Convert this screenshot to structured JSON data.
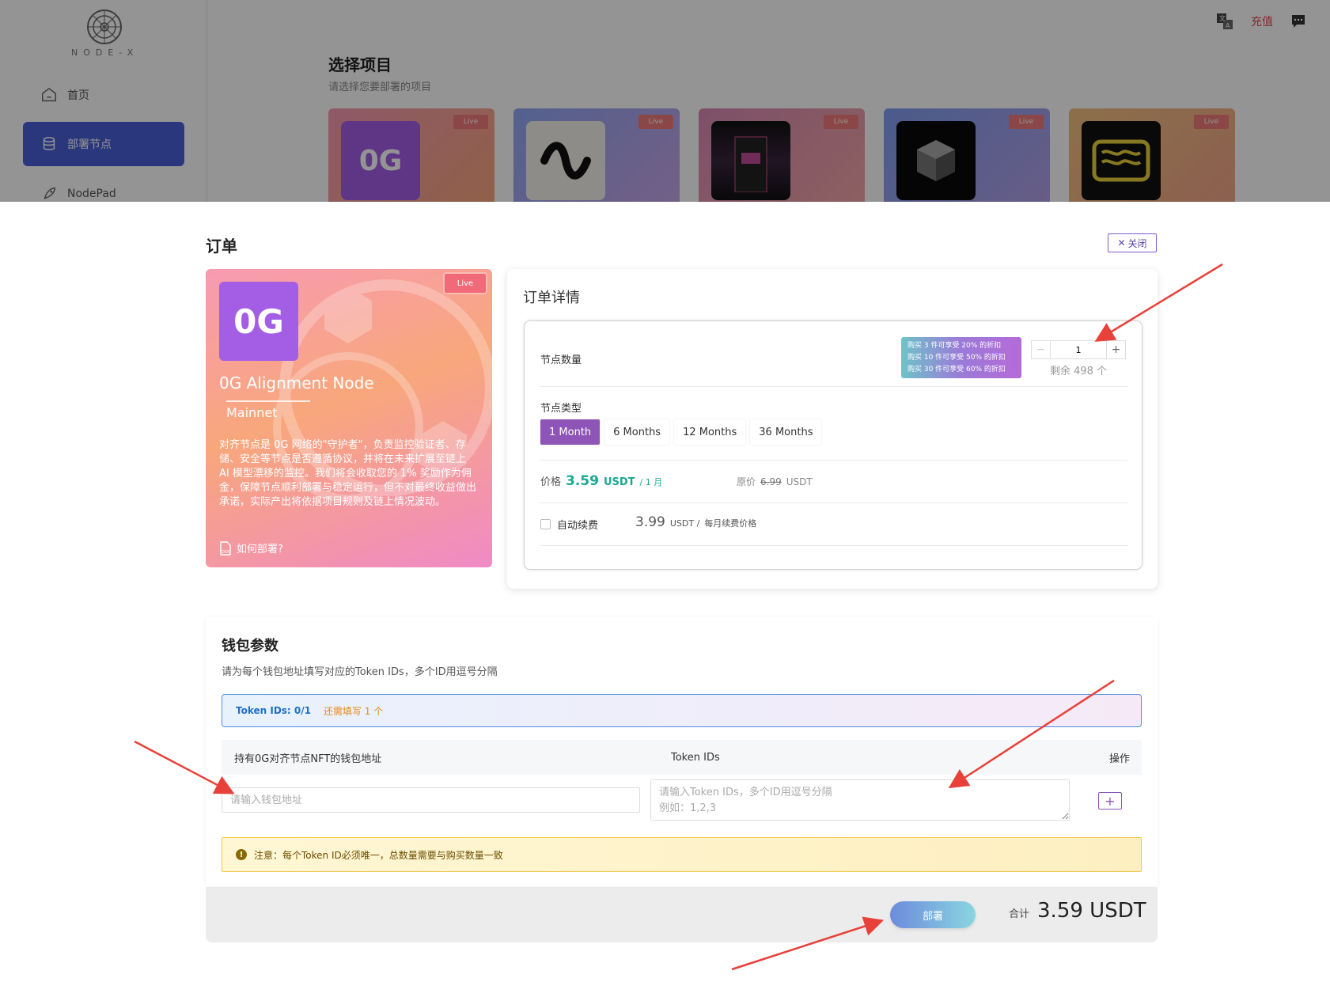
{
  "app": {
    "logo_text": "NODE-X",
    "recharge_label": "充值"
  },
  "sidebar": {
    "items": [
      {
        "label": "首页",
        "icon": "home-icon",
        "active": false
      },
      {
        "label": "部署节点",
        "icon": "database-icon",
        "active": true
      },
      {
        "label": "NodePad",
        "icon": "rocket-icon",
        "active": false
      }
    ]
  },
  "background_page": {
    "title": "选择项目",
    "subtitle": "请选择您要部署的项目",
    "projects": [
      {
        "badge": "Live",
        "logo_text": "0G"
      },
      {
        "badge": "Live",
        "logo_text": ""
      },
      {
        "badge": "Live",
        "logo_text": ""
      },
      {
        "badge": "Live",
        "logo_text": ""
      },
      {
        "badge": "Live",
        "logo_text": ""
      }
    ]
  },
  "order": {
    "title": "订单",
    "close_label": "关闭",
    "node": {
      "badge": "Live",
      "logo_text": "0G",
      "name": "0G Alignment Node",
      "network": "Mainnet",
      "description": "对齐节点是 0G 网络的\"守护者\"，负责监控验证者、存储、安全等节点是否遵循协议，并将在未来扩展至链上 AI 模型漂移的监控。我们将会收取您的 1% 奖励作为佣金，保障节点顺利部署与稳定运行，但不对最终收益做出承诺，实际产出将依据项目规则及链上情况波动。",
      "how_label": "如何部署?"
    },
    "details": {
      "title": "订单详情",
      "quantity_label": "节点数量",
      "promo_lines": [
        "购买 3 件可享受 20% 的折扣",
        "购买 10 件可享受 50% 的折扣",
        "购买 30 件可享受 60% 的折扣"
      ],
      "quantity": "1",
      "remaining": "剩余 498 个",
      "type_label": "节点类型",
      "types": [
        "1 Month",
        "6 Months",
        "12 Months",
        "36 Months"
      ],
      "selected_type": "1 Month",
      "price_label": "价格",
      "price": "3.59",
      "price_unit": "USDT",
      "price_period": "/ 1 月",
      "orig_label": "原价",
      "orig_price": "6.99",
      "orig_unit": "USDT",
      "auto_renew_label": "自动续费",
      "auto_renew_price": "3.99",
      "auto_renew_unit": "USDT /",
      "auto_renew_note": "每月续费价格",
      "auto_renew_checked": false
    }
  },
  "wallet": {
    "title": "钱包参数",
    "subtitle": "请为每个钱包地址填写对应的Token IDs，多个ID用逗号分隔",
    "token_status": "Token IDs: 0/1",
    "token_remaining": "还需填写 1 个",
    "columns": [
      "持有0G对齐节点NFT的钱包地址",
      "Token IDs",
      "操作"
    ],
    "address_placeholder": "请输入钱包地址",
    "ids_placeholder": "请输入Token IDs，多个ID用逗号分隔\n例如：1,2,3",
    "notice": "注意：每个Token ID必须唯一，总数量需要与购买数量一致"
  },
  "footer": {
    "deploy_label": "部署",
    "total_label": "合计",
    "total_amount": "3.59 USDT"
  },
  "colors": {
    "accent": "#4a5fd6",
    "selected": "#8e54b8",
    "price": "#1aa892",
    "recharge": "#e04848",
    "arrow": "#e8413a"
  }
}
